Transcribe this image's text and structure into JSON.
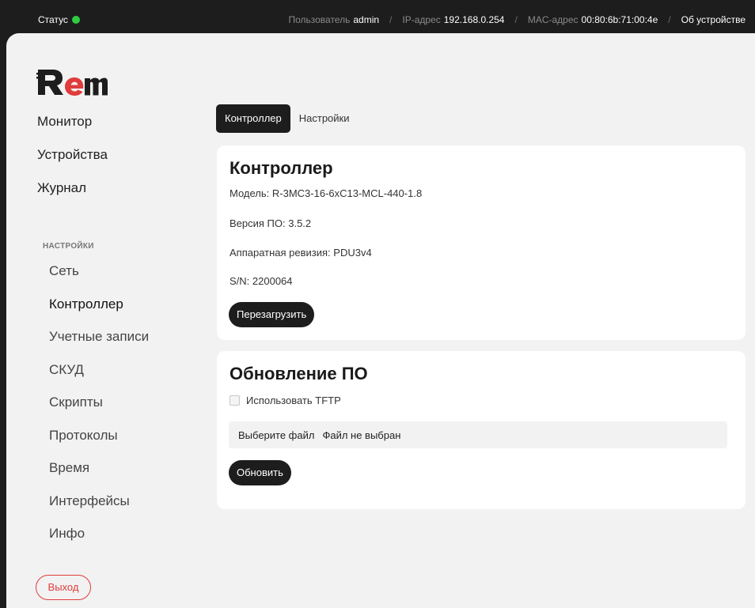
{
  "topbar": {
    "status_label": "Статус",
    "status_color": "#2ecc40",
    "user_label": "Пользователь",
    "user_value": "admin",
    "ip_label": "IP-адрес",
    "ip_value": "192.168.0.254",
    "mac_label": "MAC-адрес",
    "mac_value": "00:80:6b:71:00:4e",
    "about": "Об устройстве"
  },
  "logo": {
    "icon": "rem-logo"
  },
  "sidebar": {
    "main_items": [
      {
        "label": "Монитор"
      },
      {
        "label": "Устройства"
      },
      {
        "label": "Журнал"
      }
    ],
    "settings_title": "НАСТРОЙКИ",
    "settings_items": [
      {
        "label": "Сеть"
      },
      {
        "label": "Контроллер",
        "active": true
      },
      {
        "label": "Учетные записи"
      },
      {
        "label": "СКУД"
      },
      {
        "label": "Скрипты"
      },
      {
        "label": "Протоколы"
      },
      {
        "label": "Время"
      },
      {
        "label": "Интерфейсы"
      },
      {
        "label": "Инфо"
      }
    ],
    "logout": "Выход"
  },
  "tabs": [
    {
      "label": "Контроллер",
      "active": true
    },
    {
      "label": "Настройки"
    }
  ],
  "controller_card": {
    "title": "Контроллер",
    "model": "Модель: R-3MC3-16-6xC13-MCL-440-1.8",
    "firmware": "Версия ПО: 3.5.2",
    "hardware": "Аппаратная ревизия: PDU3v4",
    "serial": "S/N: 2200064",
    "reboot_button": "Перезагрузить"
  },
  "update_card": {
    "title": "Обновление ПО",
    "tftp_label": "Использовать TFTP",
    "tftp_checked": false,
    "choose_file": "Выберите файл",
    "no_file": "Файл не выбран",
    "update_button": "Обновить"
  },
  "colors": {
    "topbar_bg": "#1d1d1d",
    "panel_bg": "#f2f2f2",
    "accent_dark": "#1d1d1d",
    "logout_red": "#e03c3c"
  }
}
